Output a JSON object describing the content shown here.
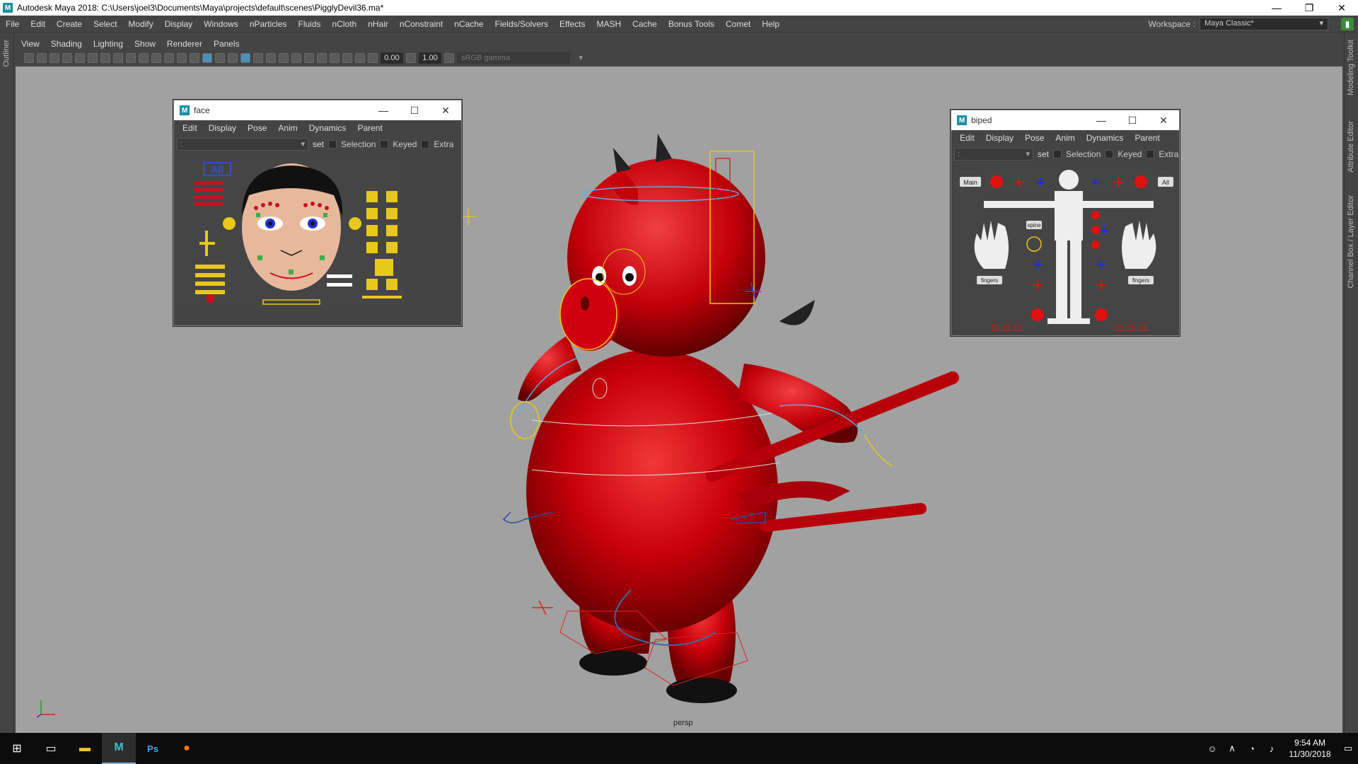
{
  "window": {
    "logo": "M",
    "title": "Autodesk Maya 2018: C:\\Users\\joel3\\Documents\\Maya\\projects\\default\\scenes\\PigglyDevil36.ma*",
    "controls": [
      "minimize-icon",
      "restore-icon",
      "close-icon"
    ]
  },
  "menubar": {
    "items": [
      "File",
      "Edit",
      "Create",
      "Select",
      "Modify",
      "Display",
      "Windows",
      "nParticles",
      "Fluids",
      "nCloth",
      "nHair",
      "nConstraint",
      "nCache",
      "Fields/Solvers",
      "Effects",
      "MASH",
      "Cache",
      "Bonus Tools",
      "Comet",
      "Help"
    ],
    "workspace_label": "Workspace :",
    "workspace_value": "Maya Classic*"
  },
  "side_tabs": {
    "left": "Outliner",
    "right": [
      "Modeling Toolkit",
      "Attribute Editor",
      "Channel Box / Layer Editor"
    ]
  },
  "panel_menu": {
    "items": [
      "View",
      "Shading",
      "Lighting",
      "Show",
      "Renderer",
      "Panels"
    ]
  },
  "panel_toolbar": {
    "field1": "0.00",
    "field2": "1.00",
    "color_space": "sRGB gamma"
  },
  "viewport": {
    "camera_label": "persp",
    "background": "#a1a1a1"
  },
  "face_window": {
    "logo": "M",
    "title": "face",
    "menu": [
      "Edit",
      "Display",
      "Pose",
      "Anim",
      "Dynamics",
      "Parent"
    ],
    "namespace": ":",
    "set_label": "set",
    "checks": [
      "Selection",
      "Keyed",
      "Extra"
    ],
    "all_label": "All"
  },
  "biped_window": {
    "logo": "M",
    "title": "biped",
    "menu": [
      "Edit",
      "Display",
      "Pose",
      "Anim",
      "Dynamics",
      "Parent"
    ],
    "namespace": ":",
    "set_label": "set",
    "checks": [
      "Selection",
      "Keyed",
      "Extra"
    ],
    "main_label": "Main",
    "all_label": "All",
    "spine_label": "spine",
    "fingers_left": "fingers",
    "fingers_right": "fingers"
  },
  "taskbar": {
    "apps": [
      "windows-start-icon",
      "task-view-icon",
      "file-explorer-icon",
      "maya-icon",
      "photoshop-icon",
      "firefox-icon"
    ],
    "ps_label": "Ps",
    "maya_label": "M",
    "time": "9:54 AM",
    "date": "11/30/2018"
  },
  "colors": {
    "accent": "#e8c81a",
    "pig_red": "#c8000a",
    "maya_teal": "#1a8fa0"
  }
}
